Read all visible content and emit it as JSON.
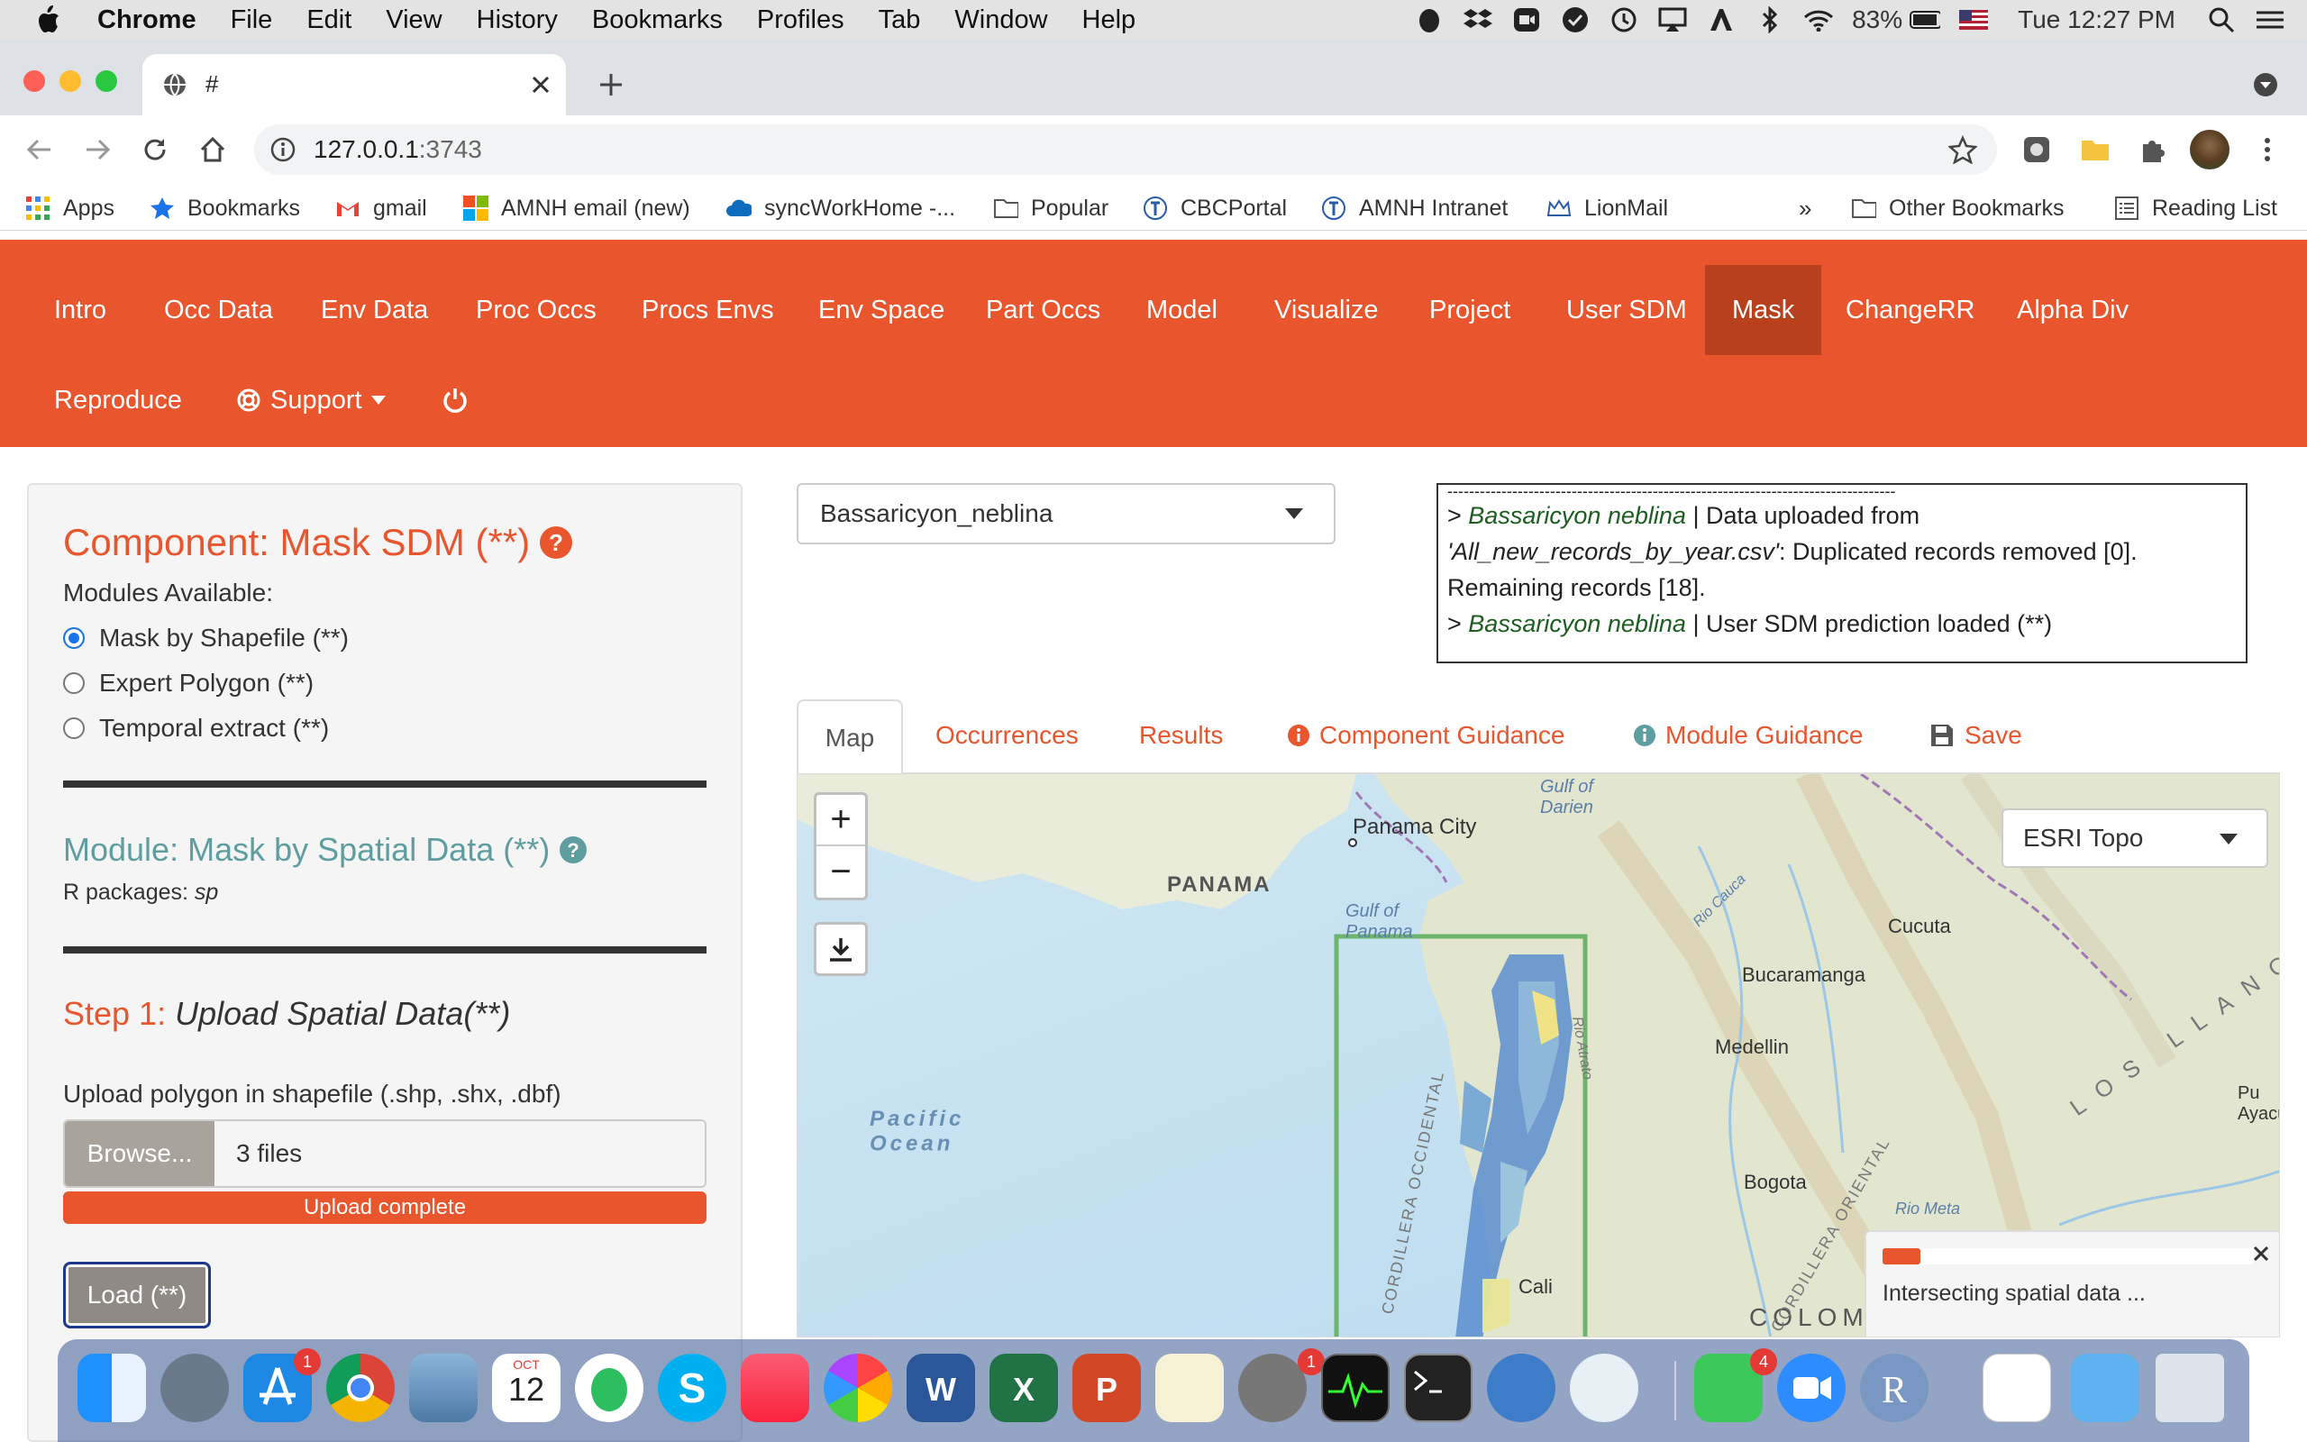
{
  "macmenu": {
    "app": "Chrome",
    "items": [
      "File",
      "Edit",
      "View",
      "History",
      "Bookmarks",
      "Profiles",
      "Tab",
      "Window",
      "Help"
    ],
    "battery": "83%",
    "clock": "Tue 12:27 PM"
  },
  "browser": {
    "tab_title": "#",
    "url_host": "127.0.0.1",
    "url_port": ":3743",
    "bookmarks": [
      "Apps",
      "Bookmarks",
      "gmail",
      "AMNH email (new)",
      "syncWorkHome -...",
      "Popular",
      "CBCPortal",
      "AMNH Intranet",
      "LionMail"
    ],
    "other_bookmarks": "Other Bookmarks",
    "reading_list": "Reading List",
    "more": "»"
  },
  "nav": {
    "row1": [
      "Intro",
      "Occ Data",
      "Env Data",
      "Proc Occs",
      "Procs Envs",
      "Env Space",
      "Part Occs",
      "Model",
      "Visualize",
      "Project",
      "User SDM",
      "Mask",
      "ChangeRR",
      "Alpha Div"
    ],
    "active": "Mask",
    "reproduce": "Reproduce",
    "support": "Support"
  },
  "left": {
    "component_title": "Component: Mask SDM (**)",
    "modules_label": "Modules Available:",
    "modules": [
      "Mask by Shapefile (**)",
      "Expert Polygon (**)",
      "Temporal extract (**)"
    ],
    "selected_module": 0,
    "module_title": "Module: Mask by Spatial Data (**)",
    "r_packages_label": "R packages:",
    "r_packages": "sp",
    "step_label": "Step 1:",
    "step_text": "Upload Spatial Data(**)",
    "upload_label": "Upload polygon in shapefile (.shp, .shx, .dbf)",
    "browse": "Browse...",
    "files": "3 files",
    "progress_text": "Upload complete",
    "load": "Load (**)"
  },
  "species_select": "Bassaricyon_neblina",
  "log": {
    "dashes": "-----------------------------------------------------------------------------------",
    "line1_species": "Bassaricyon neblina",
    "line1_text": "| Data uploaded from",
    "line2_file": "'All_new_records_by_year.csv'",
    "line2_text": ": Duplicated records removed [0].",
    "line3": "Remaining records [18].",
    "line4_species": "Bassaricyon neblina",
    "line4_text": "| User SDM prediction loaded (**)",
    "prompt": ">"
  },
  "tabs": {
    "map": "Map",
    "occurrences": "Occurrences",
    "results": "Results",
    "component_guidance": "Component Guidance",
    "module_guidance": "Module Guidance",
    "save": "Save"
  },
  "map": {
    "basemap": "ESRI Topo",
    "zoom_in": "+",
    "zoom_out": "−",
    "labels": {
      "panama_city": "Panama City",
      "panama": "PANAMA",
      "gulf_darien": "Gulf of\nDarien",
      "gulf_panama": "Gulf of\nPanama",
      "pacific": "Pacific\nOcean",
      "cucuta": "Cucuta",
      "bucaramanga": "Bucaramanga",
      "medellin": "Medellin",
      "bogota": "Bogota",
      "cali": "Cali",
      "colombia": "COLOMBIA",
      "los_llanos": "LOS LLANO",
      "rio_meta": "Rio Meta",
      "rio_cauca": "Rio Cauca",
      "pu": "Pu\nAyacu",
      "cord_occ": "CORDILLERA OCCIDENTAL",
      "cord_orient": "CORDILLERA ORIENTAL",
      "rio_atrato": "Rio Atrato"
    },
    "notification": "Intersecting spatial data ..."
  },
  "dock_badges": {
    "appstore": "1",
    "sysprefs": "1",
    "facetime": "4"
  },
  "calendar": {
    "month": "OCT",
    "day": "12"
  },
  "colors": {
    "accent": "#e9552d",
    "active": "#b8401d",
    "teal": "#5f9ea0"
  }
}
